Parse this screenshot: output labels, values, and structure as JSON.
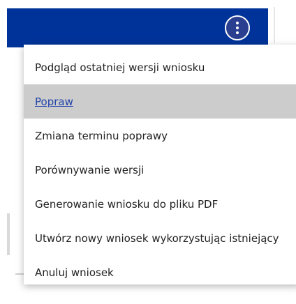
{
  "header": {
    "more_button_icon": "vertical-ellipsis-icon",
    "bar_color": "#003399"
  },
  "menu": {
    "items": [
      {
        "label": "Podgląd ostatniej wersji wniosku",
        "active": false
      },
      {
        "label": "Popraw",
        "active": true
      },
      {
        "label": "Zmiana terminu poprawy",
        "active": false
      },
      {
        "label": "Porównywanie wersji",
        "active": false
      },
      {
        "label": "Generowanie wniosku do pliku PDF",
        "active": false
      },
      {
        "label": "Utwórz nowy wniosek wykorzystując istniejący",
        "active": false
      },
      {
        "label": "Anuluj wniosek",
        "active": false
      }
    ],
    "highlight_color": "#cccccc",
    "link_color": "#2244aa"
  }
}
